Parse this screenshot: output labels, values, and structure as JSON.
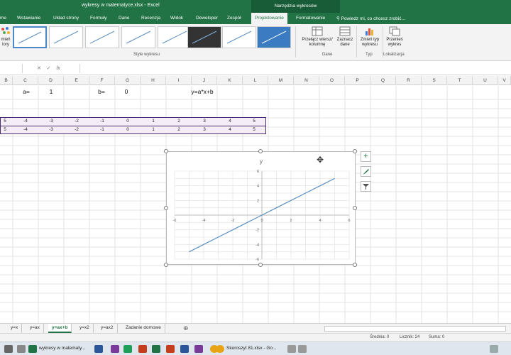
{
  "window": {
    "title": "wykresy w matematyce.xlsx - Excel",
    "tools_title": "Narzędzia wykresów"
  },
  "ribbon_tabs": [
    "me",
    "Wstawianie",
    "Układ strony",
    "Formuły",
    "Dane",
    "Recenzja",
    "Widok",
    "Deweloper",
    "Zespół",
    "Projektowanie",
    "Formatowanie"
  ],
  "tell_me": "Powiedz mi, co chcesz zrobić...",
  "ribbon": {
    "change_colors": [
      "mień",
      "lory"
    ],
    "chart_styles_label": "Style wykresu",
    "switch_row_col": [
      "Przełącz wiersz/",
      "kolumnę"
    ],
    "select_data": [
      "Zaznacz",
      "dane"
    ],
    "change_type": [
      "Zmień typ",
      "wykresu"
    ],
    "move_chart": [
      "Przenieś",
      "wykres"
    ],
    "groups": {
      "data": "Dane",
      "type": "Typ",
      "location": "Lokalizacja"
    },
    "accent": "#217346"
  },
  "formula_bar": {
    "cancel": "✕",
    "enter": "✓",
    "fx": "fx",
    "value": ""
  },
  "columns": [
    "B",
    "C",
    "D",
    "E",
    "F",
    "G",
    "H",
    "I",
    "J",
    "K",
    "L",
    "M",
    "N",
    "O",
    "P",
    "Q",
    "R",
    "S",
    "T",
    "U",
    "V"
  ],
  "cells": {
    "a_label": "a=",
    "a_value": "1",
    "b_label": "b=",
    "b_value": "0",
    "formula": "y=a*x+b"
  },
  "table": {
    "x_row": [
      "5",
      "-4",
      "-3",
      "-2",
      "-1",
      "0",
      "1",
      "2",
      "3",
      "4",
      "5"
    ],
    "y_row": [
      "5",
      "-4",
      "-3",
      "-2",
      "-1",
      "0",
      "1",
      "2",
      "3",
      "4",
      "5"
    ]
  },
  "chart_data": {
    "type": "scatter",
    "title": "y",
    "series": [
      {
        "x": [
          -5,
          -4,
          -3,
          -2,
          -1,
          0,
          1,
          2,
          3,
          4,
          5
        ],
        "y": [
          -5,
          -4,
          -3,
          -2,
          -1,
          0,
          1,
          2,
          3,
          4,
          5
        ]
      }
    ],
    "xlim": [
      -6,
      6
    ],
    "ylim": [
      -6,
      6
    ],
    "x_ticks": [
      "-6",
      "-4",
      "-2",
      "0",
      "2",
      "4",
      "6"
    ],
    "y_ticks": [
      "6",
      "4",
      "2",
      "0",
      "-2",
      "-4",
      "-6"
    ],
    "line_color": "#5b8fc0",
    "grid": true
  },
  "chart_buttons": {
    "add": "+"
  },
  "sheets": [
    "y=x",
    "y=ax",
    "y=ax+b",
    "y=x2",
    "y=ax2",
    "Zadanie domowe"
  ],
  "active_sheet": "y=ax+b",
  "add_sheet": "⊕",
  "status": {
    "average": "Średnia: 0",
    "count": "Licznik: 24",
    "sum": "Suma: 0"
  },
  "taskbar": {
    "app1": "wykresy w matematy...",
    "app2": "Skoroszyt 81.xlsx - Go..."
  }
}
